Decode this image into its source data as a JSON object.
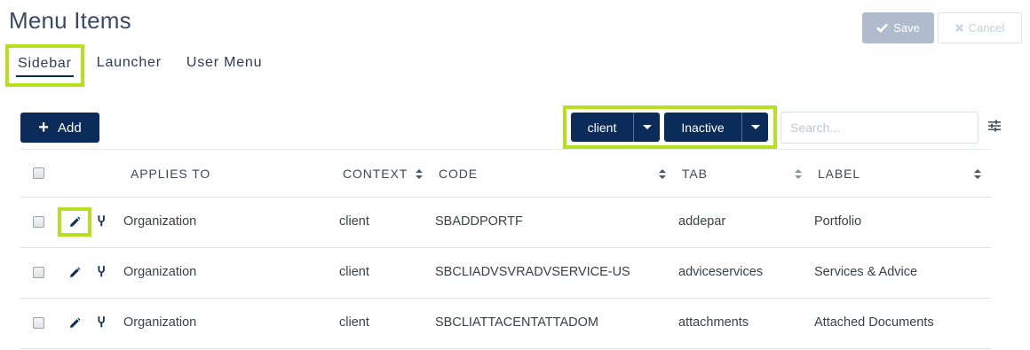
{
  "page": {
    "title": "Menu Items"
  },
  "tabs": [
    {
      "label": "Sidebar",
      "active": true
    },
    {
      "label": "Launcher",
      "active": false
    },
    {
      "label": "User Menu",
      "active": false
    }
  ],
  "actions": {
    "save_label": "Save",
    "cancel_label": "Cancel"
  },
  "toolbar": {
    "add_label": "Add",
    "context_filter": "client",
    "status_filter": "Inactive",
    "search_placeholder": "Search..."
  },
  "table": {
    "columns": [
      "APPLIES TO",
      "CONTEXT",
      "CODE",
      "TAB",
      "LABEL"
    ],
    "rows": [
      {
        "applies_to": "Organization",
        "context": "client",
        "code": "SBADDPORTF",
        "tab": "addepar",
        "label": "Portfolio"
      },
      {
        "applies_to": "Organization",
        "context": "client",
        "code": "SBCLIADVSVRADVSERVICE-US",
        "tab": "adviceservices",
        "label": "Services & Advice"
      },
      {
        "applies_to": "Organization",
        "context": "client",
        "code": "SBCLIATTACENTATTADOM",
        "tab": "attachments",
        "label": "Attached Documents"
      }
    ]
  },
  "colors": {
    "accent": "#0b2c5b",
    "highlight": "#b5e01f",
    "save_disabled": "#b0bccd"
  },
  "icons": {
    "edit": "pencil-icon",
    "branch": "fork-icon",
    "settings": "sliders-icon",
    "check": "check-icon",
    "close": "close-icon",
    "plus": "plus-icon"
  }
}
